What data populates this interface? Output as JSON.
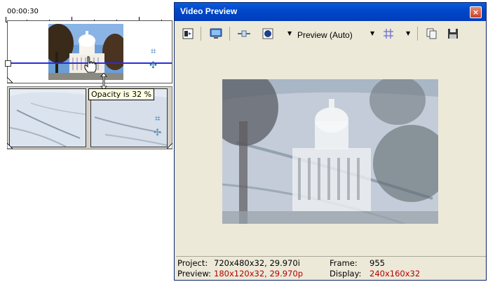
{
  "timeline": {
    "timecode": "00:00:30",
    "tooltip": "Opacity is 32 %"
  },
  "preview_window": {
    "title": "Video Preview",
    "close_label": "×",
    "toolbar": {
      "preview_quality": "Preview (Auto)"
    },
    "info": {
      "project_label": "Project:",
      "project_value": "720x480x32, 29.970i",
      "preview_label": "Preview:",
      "preview_value": "180x120x32, 29.970p",
      "frame_label": "Frame:",
      "frame_value": "955",
      "display_label": "Display:",
      "display_value": "240x160x32"
    }
  },
  "colors": {
    "titlebar": "#0a5cde",
    "envelope": "#2c2ce0",
    "info_highlight": "#b40000"
  }
}
